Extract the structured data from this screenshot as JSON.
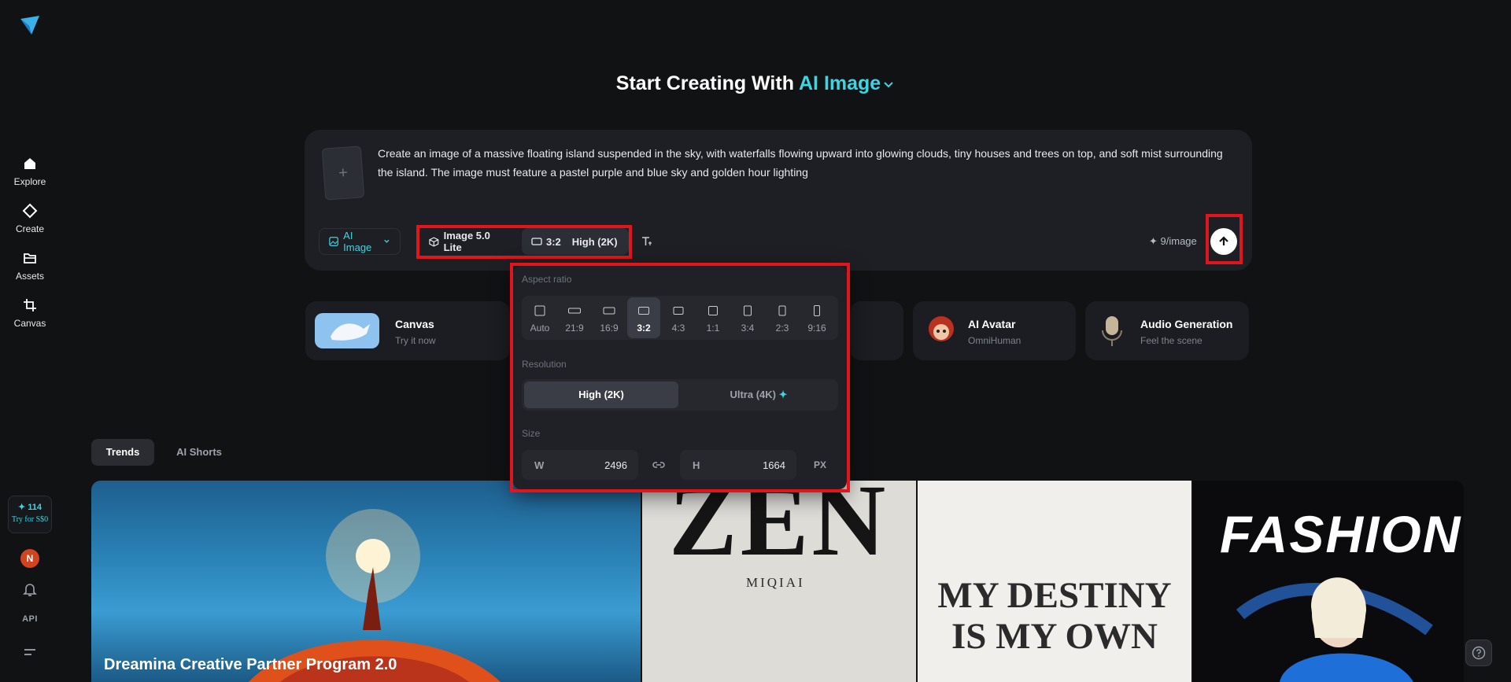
{
  "sidebar": {
    "nav": [
      {
        "label": "Explore",
        "icon": "home-icon"
      },
      {
        "label": "Create",
        "icon": "diamond-icon"
      },
      {
        "label": "Assets",
        "icon": "folder-icon"
      },
      {
        "label": "Canvas",
        "icon": "crop-icon"
      }
    ],
    "credits": {
      "amount": "✦ 114",
      "offer": "Try for S$0"
    },
    "avatar_initial": "N",
    "api_label": "API"
  },
  "heading": {
    "prefix": "Start Creating With",
    "accent": "AI Image"
  },
  "prompt": {
    "text": "Create an image of a massive floating island suspended in the sky, with waterfalls flowing upward into glowing clouds, tiny houses and trees on top, and soft mist surrounding the island. The image must feature a pastel purple and blue sky and golden hour lighting",
    "add_symbol": "+"
  },
  "toolbar": {
    "mode_label": "AI Image",
    "model_label": "Image 5.0 Lite",
    "ratio_label": "3:2",
    "resolution_label": "High (2K)",
    "cost_label": "✦ 9/image"
  },
  "popup": {
    "aspect_ratio_title": "Aspect ratio",
    "ratios": [
      "Auto",
      "21:9",
      "16:9",
      "3:2",
      "4:3",
      "1:1",
      "3:4",
      "2:3",
      "9:16"
    ],
    "selected_ratio": "3:2",
    "resolution_title": "Resolution",
    "resolutions": {
      "high": "High (2K)",
      "ultra": "Ultra (4K)"
    },
    "size_title": "Size",
    "width": {
      "key": "W",
      "value": "2496"
    },
    "height": {
      "key": "H",
      "value": "1664"
    },
    "unit": "PX"
  },
  "features": [
    {
      "title": "Canvas",
      "subtitle": "Try it now"
    },
    {
      "title": "AI Avatar",
      "subtitle": "OmniHuman"
    },
    {
      "title": "Audio Generation",
      "subtitle": "Feel the scene"
    }
  ],
  "tabs": [
    "Trends",
    "AI Shorts"
  ],
  "gallery": {
    "card1_caption": "Dreamina Creative Partner Program 2.0",
    "card2_title": "ZEN",
    "card2_sub": "MIQIAI",
    "card3_text": "MY DESTINY IS MY OWN",
    "card4_text": "FASHION"
  },
  "colors": {
    "accent": "#3ad6e4",
    "highlight": "#e2141c",
    "background": "#111214"
  }
}
